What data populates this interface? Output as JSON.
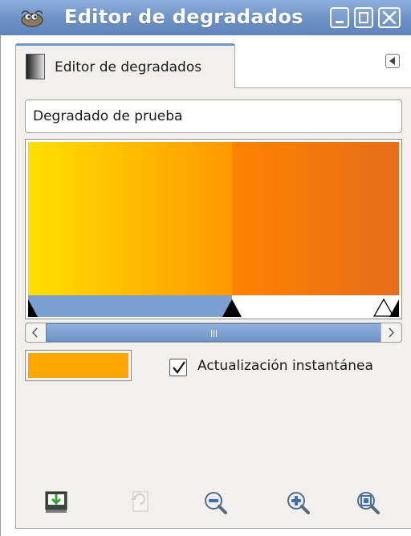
{
  "window": {
    "title": "Editor de degradados",
    "icon": "gimp-wilber-icon",
    "controls": [
      "minimize-icon",
      "maximize-icon",
      "close-icon"
    ]
  },
  "tab": {
    "label": "Editor de degradados",
    "icon": "gradient-icon",
    "menu_icon": "tab-menu-arrow-icon"
  },
  "gradient": {
    "name": "Degradado de prueba",
    "segments": [
      {
        "start_color": "#fee000",
        "end_color": "#fe9900",
        "start": 0.0,
        "end": 0.55
      },
      {
        "start_color": "#fe8300",
        "end_color": "#e76c19",
        "start": 0.55,
        "end": 1.0
      }
    ],
    "selected_segment": 0
  },
  "scrollbar": {
    "left_icon": "chevron-left-icon",
    "right_icon": "chevron-right-icon"
  },
  "color": {
    "swatch": "#fea700"
  },
  "instant_update": {
    "label": "Actualización instantánea",
    "checked": true
  },
  "toolbar": {
    "buttons": [
      {
        "name": "save-icon",
        "enabled": true
      },
      {
        "name": "revert-icon",
        "enabled": false
      },
      {
        "name": "zoom-out-icon",
        "enabled": true
      },
      {
        "name": "zoom-in-icon",
        "enabled": true
      },
      {
        "name": "zoom-all-icon",
        "enabled": true
      }
    ]
  },
  "colors": {
    "titlebar": "#6f93c6",
    "selection": "#7b9fd1",
    "panel": "#f1f0ee"
  }
}
